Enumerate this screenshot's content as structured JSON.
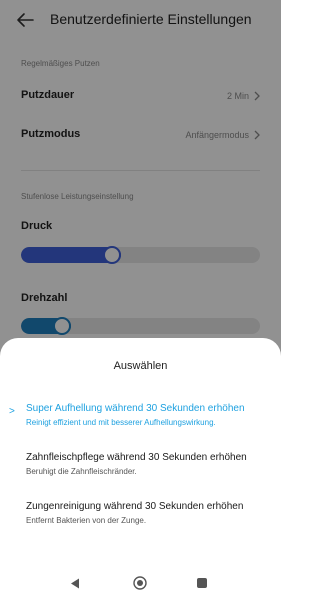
{
  "header": {
    "title": "Benutzerdefinierte Einstellungen",
    "back_icon": "back-arrow-icon"
  },
  "sections": {
    "regular": {
      "label": "Regelmäßiges Putzen",
      "duration": {
        "label": "Putzdauer",
        "value": "2 Min"
      },
      "mode": {
        "label": "Putzmodus",
        "value": "Anfängermodus"
      }
    },
    "power": {
      "label": "Stufenlose Leistungseinstellung",
      "pressure": {
        "label": "Druck",
        "level": 0.38,
        "color": "#3f5fd9"
      },
      "speed": {
        "label": "Drehzahl",
        "level": 0.17,
        "color": "#1f7fbf"
      }
    }
  },
  "sheet": {
    "title": "Auswählen",
    "accent_color": "#1ea1e0",
    "selected_marker": ">",
    "options": [
      {
        "title": "Super Aufhellung während 30 Sekunden erhöhen",
        "subtitle": "Reinigt effizient und mit besserer Aufhellungswirkung.",
        "selected": true
      },
      {
        "title": "Zahnfleischpflege während 30 Sekunden erhöhen",
        "subtitle": "Beruhigt die Zahnfleischränder.",
        "selected": false
      },
      {
        "title": "Zungenreinigung während 30 Sekunden erhöhen",
        "subtitle": "Entfernt Bakterien von der Zunge.",
        "selected": false
      }
    ]
  },
  "navbar": {
    "back": "nav-back-icon",
    "home": "nav-home-icon",
    "recents": "nav-recents-icon"
  }
}
